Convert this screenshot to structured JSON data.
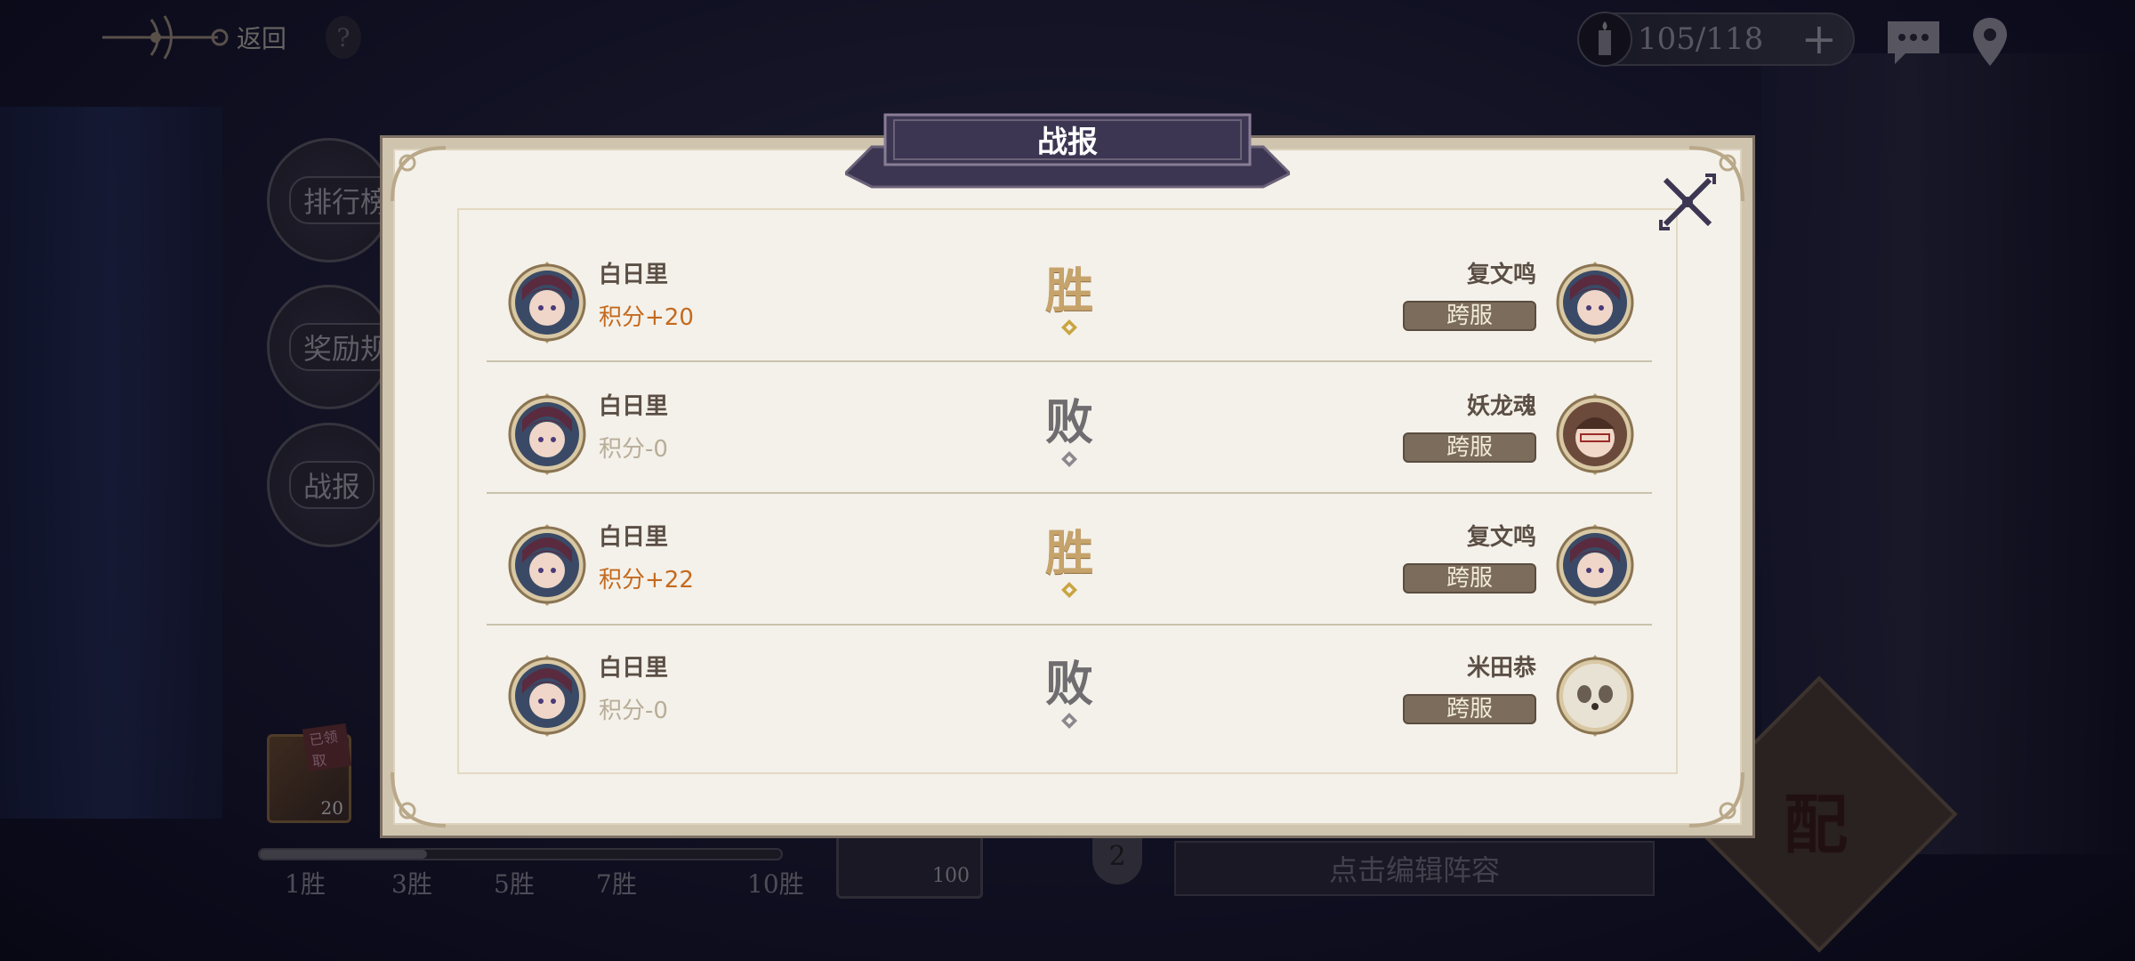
{
  "top_bar": {
    "back_label": "返回",
    "help_label": "?",
    "stamina": "105/118",
    "plus_label": "+"
  },
  "side_menu": {
    "ranking_label": "排行榜",
    "rewards_label": "奖励规则",
    "report_label": "战报"
  },
  "progress": {
    "reward_count": "20",
    "claimed_tag": "已领取",
    "fill_fraction": 0.32,
    "milestones": [
      "1胜",
      "3胜",
      "5胜",
      "7胜",
      "10胜"
    ],
    "box_count": "100"
  },
  "bottom": {
    "lineup_text": "点击编辑阵容",
    "shield_num": "2",
    "match_label": "配"
  },
  "modal": {
    "title": "战报",
    "records": [
      {
        "left_name": "白日里",
        "score": "积分+20",
        "result": "胜",
        "outcome": "win",
        "right_name": "复文鸣",
        "server": "跨服",
        "opp_avatar": "boy"
      },
      {
        "left_name": "白日里",
        "score": "积分-0",
        "result": "败",
        "outcome": "lose",
        "right_name": "妖龙魂",
        "server": "跨服",
        "opp_avatar": "girl"
      },
      {
        "left_name": "白日里",
        "score": "积分+22",
        "result": "胜",
        "outcome": "win",
        "right_name": "复文鸣",
        "server": "跨服",
        "opp_avatar": "boy"
      },
      {
        "left_name": "白日里",
        "score": "积分-0",
        "result": "败",
        "outcome": "lose",
        "right_name": "米田恭",
        "server": "跨服",
        "opp_avatar": "panda"
      }
    ]
  },
  "colors": {
    "win_score": "#c46a1e",
    "lose_score": "#b8ad98",
    "win_result": "#c6a36b",
    "lose_result": "#6f6d70",
    "title_plate": "#3c3652"
  }
}
